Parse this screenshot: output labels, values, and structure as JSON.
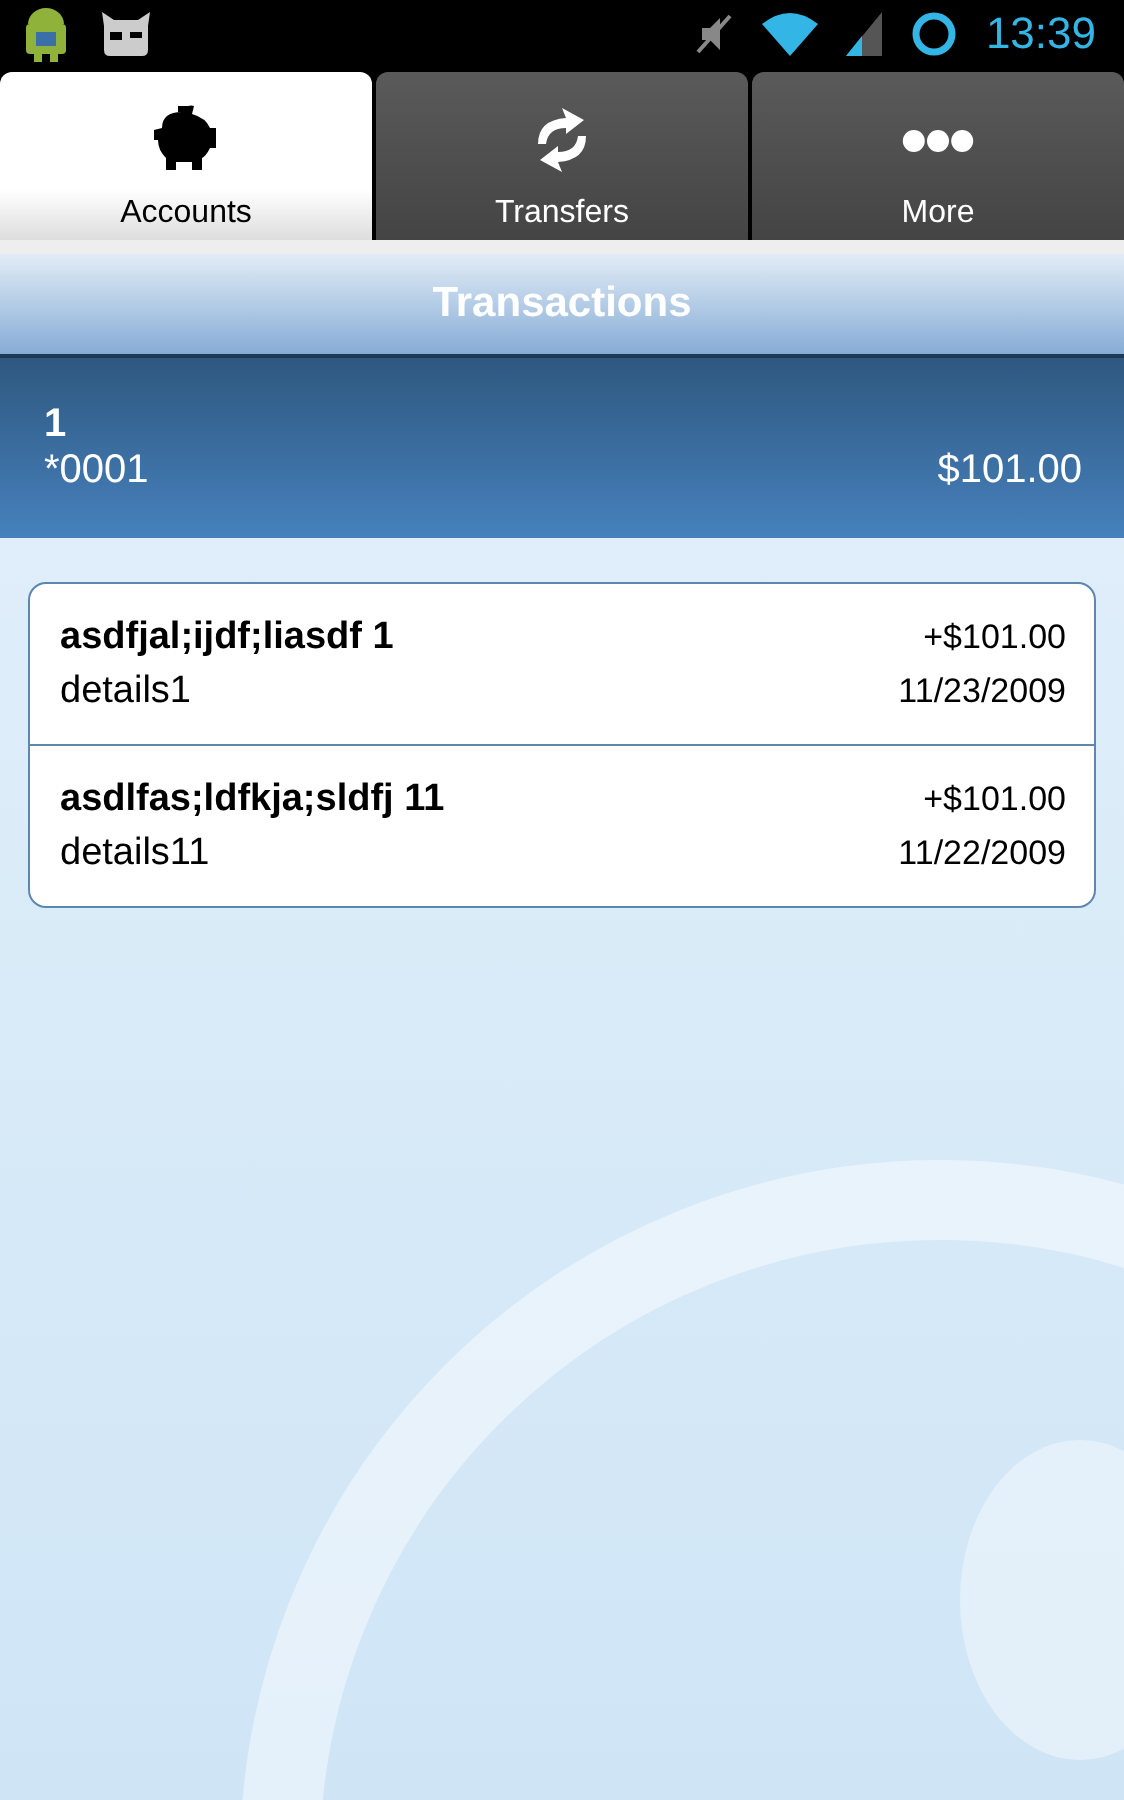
{
  "status_bar": {
    "time": "13:39"
  },
  "tabs": [
    {
      "label": "Accounts",
      "kind": "piggy",
      "selected": true
    },
    {
      "label": "Transfers",
      "kind": "sync",
      "selected": false
    },
    {
      "label": "More",
      "kind": "more",
      "selected": false
    }
  ],
  "title": "Transactions",
  "account": {
    "name": "1",
    "number": "*0001",
    "balance": "$101.00"
  },
  "transactions": [
    {
      "description": "asdfjal;ijdf;liasdf 1",
      "details": "details1",
      "amount": "+$101.00",
      "date": "11/23/2009"
    },
    {
      "description": "asdlfas;ldfkja;sldfj 11",
      "details": "details11",
      "amount": "+$101.00",
      "date": "11/22/2009"
    }
  ]
}
